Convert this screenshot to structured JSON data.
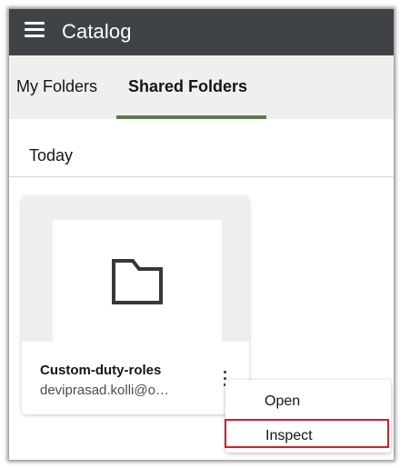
{
  "header": {
    "menu_icon": "hamburger-menu-icon",
    "title": "Catalog"
  },
  "tabs": [
    {
      "label": "My Folders",
      "active": false
    },
    {
      "label": "Shared Folders",
      "active": true
    }
  ],
  "section": {
    "title": "Today"
  },
  "card": {
    "icon": "folder-icon",
    "name": "Custom-duty-roles",
    "owner": "deviprasad.kolli@o…",
    "more_icon": "kebab-menu-icon"
  },
  "context_menu": {
    "items": [
      {
        "label": "Open",
        "highlighted": false
      },
      {
        "label": "Inspect",
        "highlighted": true
      }
    ]
  },
  "colors": {
    "header_bg": "#3f4348",
    "tab_bar_bg": "#f1efed",
    "active_tab_underline": "#5c7a4e",
    "highlight_border": "#d0202c"
  }
}
